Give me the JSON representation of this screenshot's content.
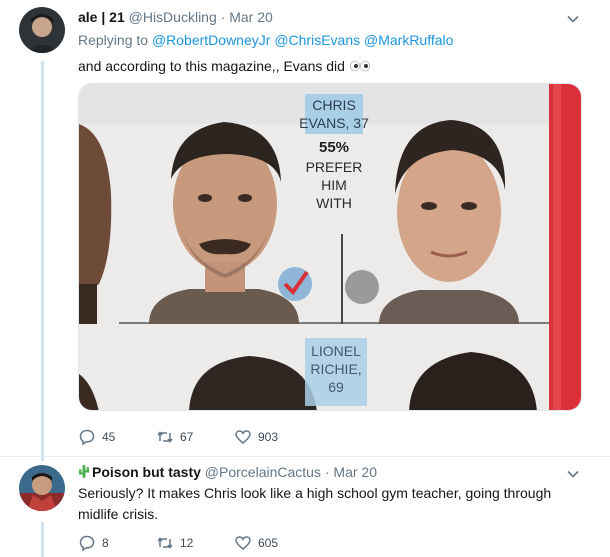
{
  "tweet1": {
    "name": "ale | 21",
    "handle": "@HisDuckling",
    "dot": "·",
    "date": "Mar 20",
    "replying_label": "Replying to",
    "mentions": [
      "@RobertDowneyJr",
      "@ChrisEvans",
      "@MarkRuffalo"
    ],
    "text": "and according to this magazine,, Evans did",
    "media": {
      "label_name": [
        "CHRIS",
        "EVANS, 37"
      ],
      "percent": "55%",
      "prefer": [
        "PREFER",
        "HIM",
        "WITH"
      ],
      "label2": [
        "LIONEL",
        "RICHIE,",
        "69"
      ]
    },
    "actions": {
      "replies": "45",
      "retweets": "67",
      "likes": "903"
    }
  },
  "tweet2": {
    "name": "Poison but tasty",
    "handle": "@PorcelainCactus",
    "dot": "·",
    "date": "Mar 20",
    "text": "Seriously? It makes Chris look like a high school gym teacher, going through midlife crisis.",
    "actions": {
      "replies": "8",
      "retweets": "12",
      "likes": "605"
    }
  },
  "colors": {
    "link": "#1b95e0",
    "secondary": "#657786",
    "thread_line": "#cfe3f2",
    "label_bg": "#a9cfe6"
  }
}
